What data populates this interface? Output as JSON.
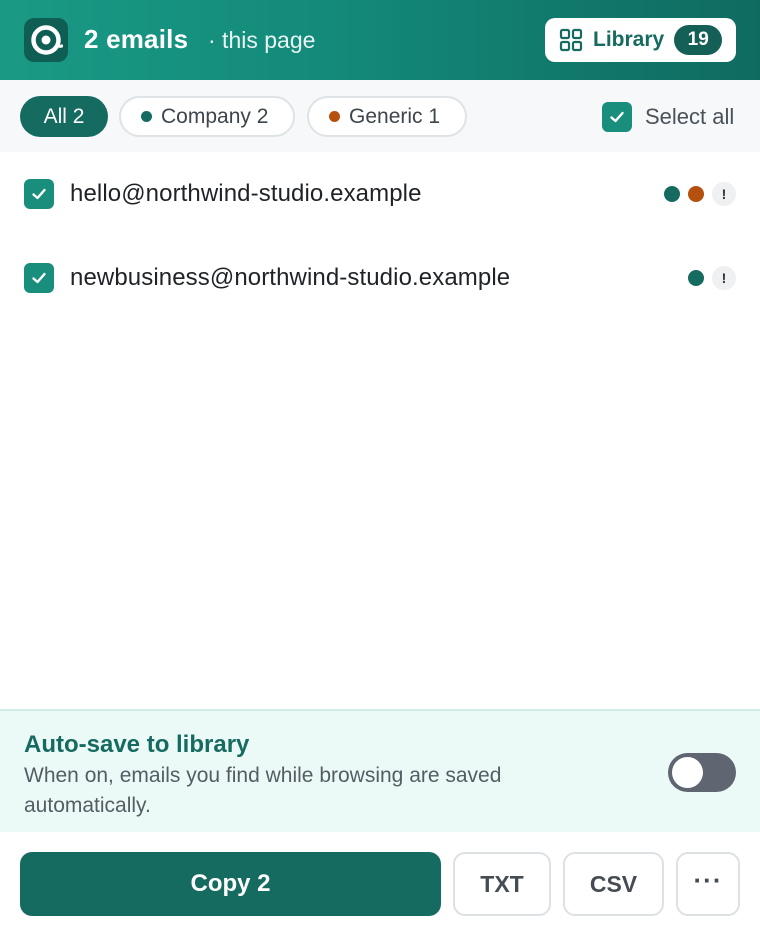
{
  "header": {
    "title": "2 emails",
    "subtitle": "· this page",
    "library_label": "Library",
    "library_count": "19",
    "logo_icon": "at-sign-icon",
    "library_icon": "grid-icon"
  },
  "filters": {
    "chips": [
      {
        "label": "All 2",
        "active": true
      },
      {
        "label": "Company 2",
        "dot_color": "#166b61"
      },
      {
        "label": "Generic 1",
        "dot_color": "#b5500f"
      }
    ],
    "select_all_label": "Select all",
    "select_all_checked": true
  },
  "emails": [
    {
      "address": "hello@northwind-studio.example",
      "checked": true,
      "tags": [
        "#166b61",
        "#b5500f"
      ],
      "warning": "!"
    },
    {
      "address": "newbusiness@northwind-studio.example",
      "checked": true,
      "tags": [
        "#166b61"
      ],
      "warning": "!"
    }
  ],
  "autosave": {
    "title": "Auto-save to library",
    "description": "When on, emails you find while browsing are saved automatically.",
    "enabled": false
  },
  "actions": {
    "copy_label": "Copy 2",
    "txt_label": "TXT",
    "csv_label": "CSV",
    "more_label": "···"
  },
  "colors": {
    "brand": "#166b61",
    "company": "#166b61",
    "generic": "#b5500f",
    "checkbox": "#1a8e7d"
  }
}
